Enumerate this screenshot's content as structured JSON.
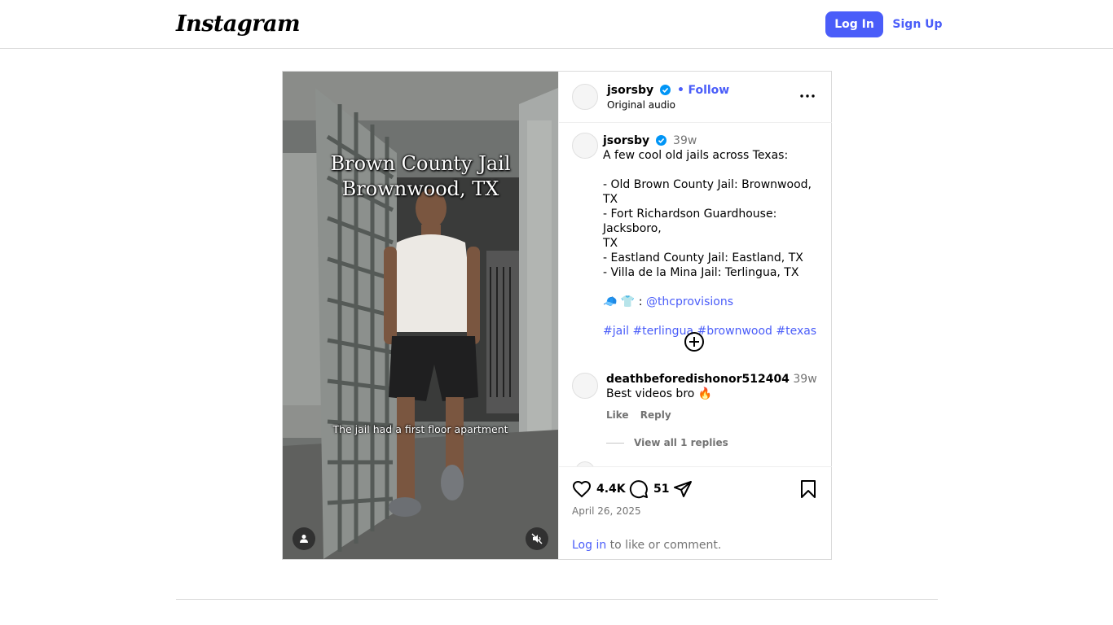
{
  "topbar": {
    "logo": "Instagram",
    "login_label": "Log In",
    "signup_label": "Sign Up"
  },
  "media": {
    "title_line1": "Brown County Jail",
    "title_line2": "Brownwood, TX",
    "caption": "The jail had a first floor apartment",
    "user_icon": "person-icon",
    "mute_icon": "muted-speaker-icon"
  },
  "header": {
    "username": "jsorsby",
    "separator": "•",
    "follow_label": "Follow",
    "audio": "Original audio",
    "more_icon": "more-options-icon"
  },
  "caption": {
    "username": "jsorsby",
    "age": "39w",
    "lines": [
      "A few cool old jails across Texas:",
      "",
      "- Old Brown County Jail: Brownwood, TX",
      "- Fort Richardson Guardhouse: Jacksboro,",
      "TX",
      "- Eastland County Jail: Eastland, TX",
      "- Villa de la Mina Jail: Terlingua, TX",
      ""
    ],
    "emoji_prefix": "🧢 👕 : ",
    "mention": "@thcprovisions",
    "hashtags": [
      "#jail",
      "#terlingua",
      "#brownwood",
      "#texas"
    ]
  },
  "comment": {
    "username": "deathbeforedishonor512404",
    "age": "39w",
    "text": "Best videos bro 🔥",
    "like_label": "Like",
    "reply_label": "Reply",
    "view_replies": "View all 1 replies"
  },
  "actions": {
    "likes": "4.4K",
    "comments": "51",
    "date": "April 26, 2025",
    "login_link": "Log in",
    "login_rest": " to like or comment."
  },
  "colors": {
    "accent": "#4a5df9",
    "verified": "#0095f6",
    "muted": "#737373",
    "border": "#dbdbdb"
  }
}
